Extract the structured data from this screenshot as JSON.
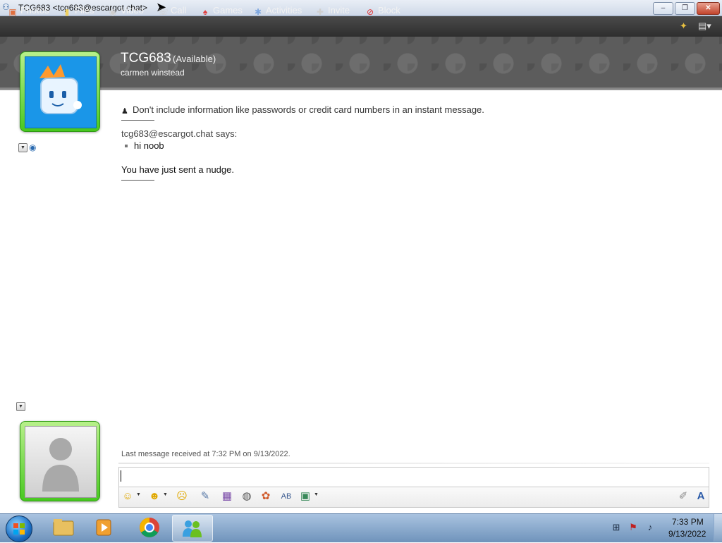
{
  "window": {
    "title": "TCG683 <tcg683@escargot.chat>",
    "controls": {
      "minimize": "‒",
      "maximize": "❐",
      "close": "✕"
    }
  },
  "toolbar": {
    "items": [
      {
        "label": "Photos",
        "icon": "photos-icon"
      },
      {
        "label": "Files",
        "icon": "files-icon"
      },
      {
        "label": "Video",
        "icon": "video-icon"
      },
      {
        "label": "Call",
        "icon": "call-icon"
      },
      {
        "label": "Games",
        "icon": "games-icon"
      },
      {
        "label": "Activities",
        "icon": "activities-icon"
      },
      {
        "label": "Invite",
        "icon": "invite-icon"
      },
      {
        "label": "Block",
        "icon": "block-icon"
      }
    ]
  },
  "contact": {
    "name": "TCG683",
    "status": "(Available)",
    "personal_message": "carmen winstead"
  },
  "conversation": {
    "notice": "Don't include information like passwords or credit card numbers in an instant message.",
    "sender_says": "tcg683@escargot.chat says:",
    "message": "hi noob",
    "nudge": "You have just sent a nudge.",
    "last_received": "Last message received at 7:32 PM on 9/13/2022."
  },
  "input": {
    "value": ""
  },
  "taskbar": {
    "time": "7:33 PM",
    "date": "9/13/2022"
  },
  "colors": {
    "avatar_frame": "#48c820",
    "toolbar_bg": "#3a3a3a",
    "banner_bg": "#5c5c5c",
    "user_avatar_bg": "#1a96e8"
  }
}
